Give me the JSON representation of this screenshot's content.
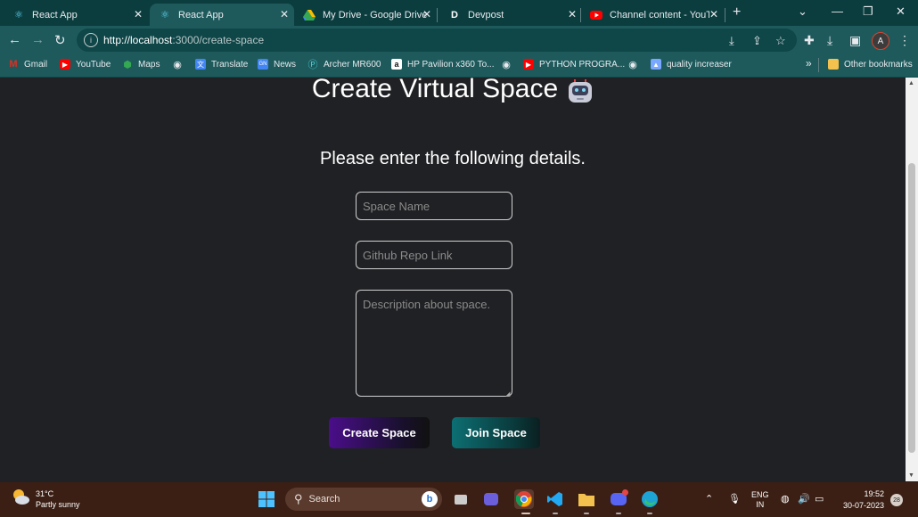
{
  "browser": {
    "tabs": [
      {
        "title": "React App",
        "icon": "react-icon"
      },
      {
        "title": "React App",
        "icon": "react-icon",
        "active": true
      },
      {
        "title": "My Drive - Google Drive",
        "icon": "drive-icon"
      },
      {
        "title": "Devpost",
        "icon": "devpost-icon",
        "icon_text": "D"
      },
      {
        "title": "Channel content - YouTube",
        "icon": "youtube-icon"
      }
    ],
    "url_host": "http://localhost",
    "url_path": ":3000/create-space",
    "profile_initial": "A",
    "bookmarks": [
      {
        "label": "Gmail",
        "icon": "gmail-icon",
        "color": "#d93025"
      },
      {
        "label": "YouTube",
        "icon": "youtube-icon",
        "color": "#ff0000"
      },
      {
        "label": "Maps",
        "icon": "maps-icon",
        "color": "#34a853"
      },
      {
        "label": "",
        "icon": "globe-icon",
        "color": "#e8eaed"
      },
      {
        "label": "Translate",
        "icon": "translate-icon",
        "color": "#4285f4"
      },
      {
        "label": "News",
        "icon": "news-icon",
        "color": "#4285f4"
      },
      {
        "label": "Archer MR600",
        "icon": "tplink-icon",
        "color": "#4acbd6"
      },
      {
        "label": "HP Pavilion x360 To...",
        "icon": "amazon-icon",
        "color": "#ffffff"
      },
      {
        "label": "",
        "icon": "globe-icon",
        "color": "#e8eaed"
      },
      {
        "label": "PYTHON PROGRA...",
        "icon": "youtube-icon",
        "color": "#ff0000"
      },
      {
        "label": "",
        "icon": "globe-icon",
        "color": "#e8eaed"
      },
      {
        "label": "quality increaser",
        "icon": "image-icon",
        "color": "#7aa7ff"
      }
    ],
    "bookmarks_overflow": "»",
    "other_bookmarks": "Other bookmarks"
  },
  "page": {
    "title": "Create Virtual Space",
    "subtitle": "Please enter the following details.",
    "space_name_placeholder": "Space Name",
    "repo_placeholder": "Github Repo Link",
    "description_placeholder": "Description about space.",
    "create_button": "Create Space",
    "join_button": "Join Space"
  },
  "taskbar": {
    "temperature": "31°C",
    "weather": "Partly sunny",
    "search_label": "Search",
    "language_line1": "ENG",
    "language_line2": "IN",
    "time": "19:52",
    "date": "30-07-2023",
    "notification_count": "28"
  }
}
